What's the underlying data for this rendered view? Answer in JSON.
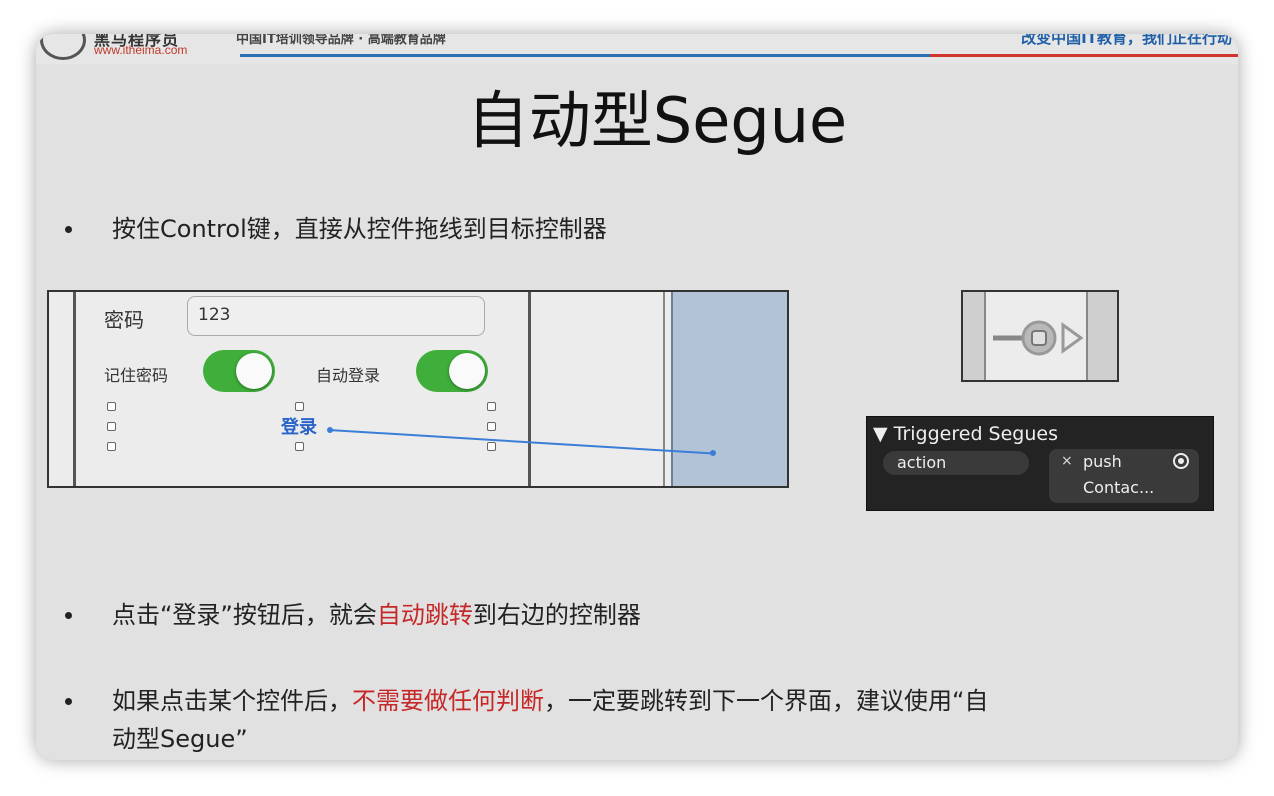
{
  "header": {
    "logo_text": "黑马程序员",
    "logo_url": "www.itheima.com",
    "slogan_left": "中国IT培训领导品牌 · 高端教育品牌",
    "slogan_right": "改变中国IT教育，我们正在行动"
  },
  "slide": {
    "title": "自动型Segue",
    "bullet1": "按住Control键，直接从控件拖线到目标控制器",
    "bullet2_pre": "点击“登录”按钮后，就会",
    "bullet2_red": "自动跳转",
    "bullet2_post": "到右边的控制器",
    "bullet3_pre": "如果点击某个控件后，",
    "bullet3_red": "不需要做任何判断",
    "bullet3_post": "，一定要跳转到下一个界面，建议使用“自",
    "bullet3_line2": "动型Segue”"
  },
  "storyboard": {
    "password_label": "密码",
    "password_value": "123",
    "remember_label": "记住密码",
    "autologin_label": "自动登录",
    "login_button": "登录",
    "remember_on": true,
    "autologin_on": true
  },
  "segue_panel": {
    "header": "▼ Triggered Segues",
    "trigger": "action",
    "remove_icon": "×",
    "segue_type": "push",
    "destination": "Contac..."
  },
  "colors": {
    "accent_red": "#c62828",
    "toggle_green": "#3fae3a",
    "link_blue": "#2a64c8"
  }
}
